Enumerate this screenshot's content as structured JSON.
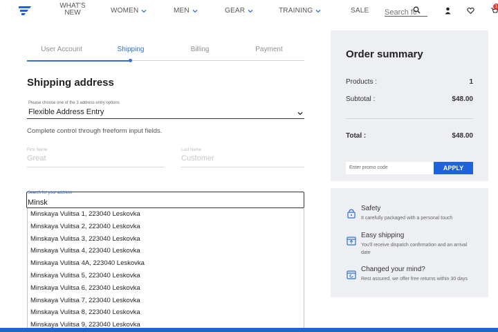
{
  "nav": {
    "whats_new": "WHAT'S NEW",
    "women": "WOMEN",
    "men": "MEN",
    "gear": "GEAR",
    "training": "TRAINING",
    "sale": "SALE",
    "search_placeholder": "Search fo",
    "cart_count": "1"
  },
  "steps": [
    "User Account",
    "Shipping",
    "Billing",
    "Payment"
  ],
  "shipping": {
    "title": "Shipping address",
    "select_label": "Please choose one of the 3 address entry options",
    "select_value": "Flexible Address Entry",
    "select_desc": "Complete control through freeform input fields.",
    "first_name_label": "First Name",
    "first_name_value": "Great",
    "last_name_label": "Last Name",
    "last_name_value": "Customer",
    "address_label": "Search for your address",
    "address_value": "Minsk"
  },
  "suggestions": [
    "Minskaya Vulitsa 1, 223040 Leskovka",
    "Minskaya Vulitsa 2, 223040 Leskovka",
    "Minskaya Vulitsa 3, 223040 Leskovka",
    "Minskaya Vulitsa 4, 223040 Leskovka",
    "Minskaya Vulitsa 4A, 223040 Leskovka",
    "Minskaya Vulitsa 5, 223040 Leskovka",
    "Minskaya Vulitsa 6, 223040 Leskovka",
    "Minskaya Vulitsa 7, 223040 Leskovka",
    "Minskaya Vulitsa 8, 223040 Leskovka",
    "Minskaya Vulitsa 9, 223040 Leskovka"
  ],
  "summary": {
    "title": "Order summary",
    "products_label": "Products :",
    "products_value": "1",
    "subtotal_label": "Subtotal :",
    "subtotal_value": "$48.00",
    "total_label": "Total :",
    "total_value": "$48.00",
    "promo_placeholder": "Enter promo code",
    "apply_label": "APPLY"
  },
  "benefits": [
    {
      "icon": "lock-icon",
      "title": "Safety",
      "desc": "It carefully packaged with a personal touch"
    },
    {
      "icon": "box-icon",
      "title": "Easy shipping",
      "desc": "You'll receive dispatch confirmation and an arrival date"
    },
    {
      "icon": "return-box-icon",
      "title": "Changed your mind?",
      "desc": "Rest assured, we offer free returns within 30 days"
    }
  ],
  "colors": {
    "accent": "#1e63d9",
    "panel": "#edeff2",
    "badge": "#e53935"
  }
}
